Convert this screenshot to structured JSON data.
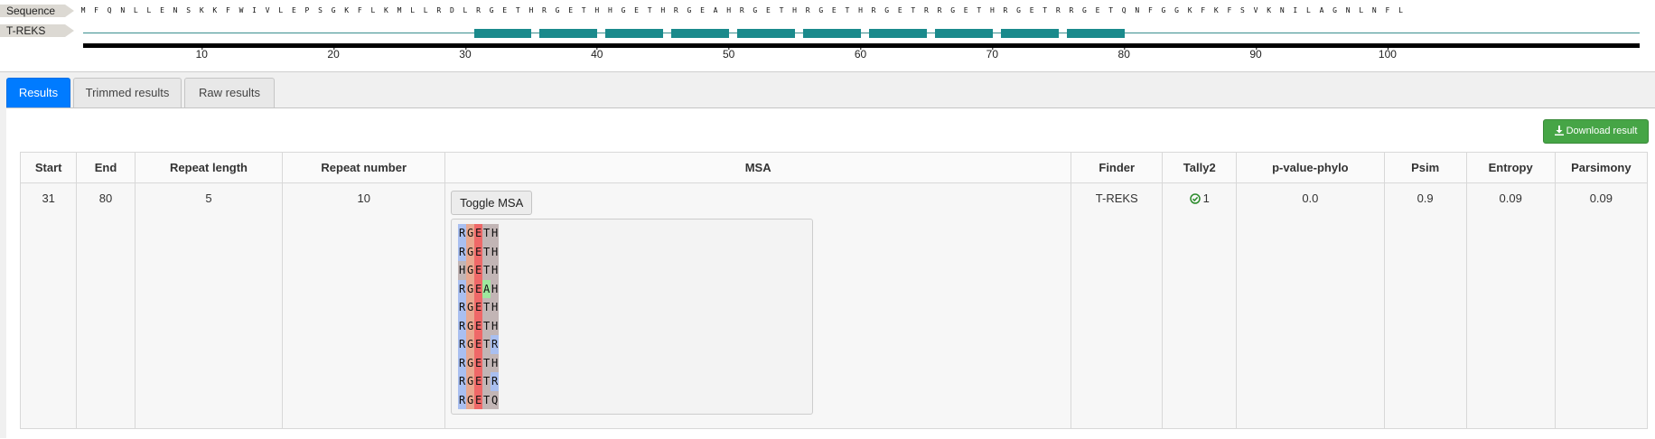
{
  "viewer": {
    "sequence_label": "Sequence",
    "treks_label": "T-REKS",
    "sequence": "MFQNLLENSKKFWIVLEPSGKFLKMLLRDLRGETHRGETHHGETHRGEAHRGETHRGETHRGETRRGETHRGETRRGETQNFGGKFKFSVKNILAGNLNFL",
    "repeat_blocks": [
      [
        31,
        35
      ],
      [
        36,
        40
      ],
      [
        41,
        45
      ],
      [
        46,
        50
      ],
      [
        51,
        55
      ],
      [
        56,
        60
      ],
      [
        61,
        65
      ],
      [
        66,
        70
      ],
      [
        71,
        75
      ],
      [
        76,
        80
      ]
    ],
    "axis_ticks": [
      "10",
      "20",
      "30",
      "40",
      "50",
      "60",
      "70",
      "80",
      "90",
      "100"
    ],
    "track_color": "#1a8a8c"
  },
  "tabs": [
    {
      "label": "Results",
      "active": true
    },
    {
      "label": "Trimmed results",
      "active": false
    },
    {
      "label": "Raw results",
      "active": false
    }
  ],
  "download_label": "Download result",
  "table": {
    "headers": [
      "Start",
      "End",
      "Repeat length",
      "Repeat number",
      "MSA",
      "Finder",
      "Tally2",
      "p-value-phylo",
      "Psim",
      "Entropy",
      "Parsimony"
    ],
    "rows": [
      {
        "start": "31",
        "end": "80",
        "repeat_length": "5",
        "repeat_number": "10",
        "toggle_label": "Toggle MSA",
        "msa": [
          "RGETH",
          "RGETH",
          "HGETH",
          "RGEAH",
          "RGETH",
          "RGETH",
          "RGETR",
          "RGETH",
          "RGETR",
          "RGETQ"
        ],
        "finder": "T-REKS",
        "tally2": "1",
        "p_value_phylo": "0.0",
        "psim": "0.9",
        "entropy": "0.09",
        "parsimony": "0.09"
      }
    ]
  },
  "residue_colors": {
    "R": "#a9bff0",
    "H": "#c2b5b5",
    "G": "#e8a890",
    "E": "#ef6868",
    "T": "#c2b5b5",
    "A": "#9ee89e",
    "Q": "#c2b5b5"
  }
}
